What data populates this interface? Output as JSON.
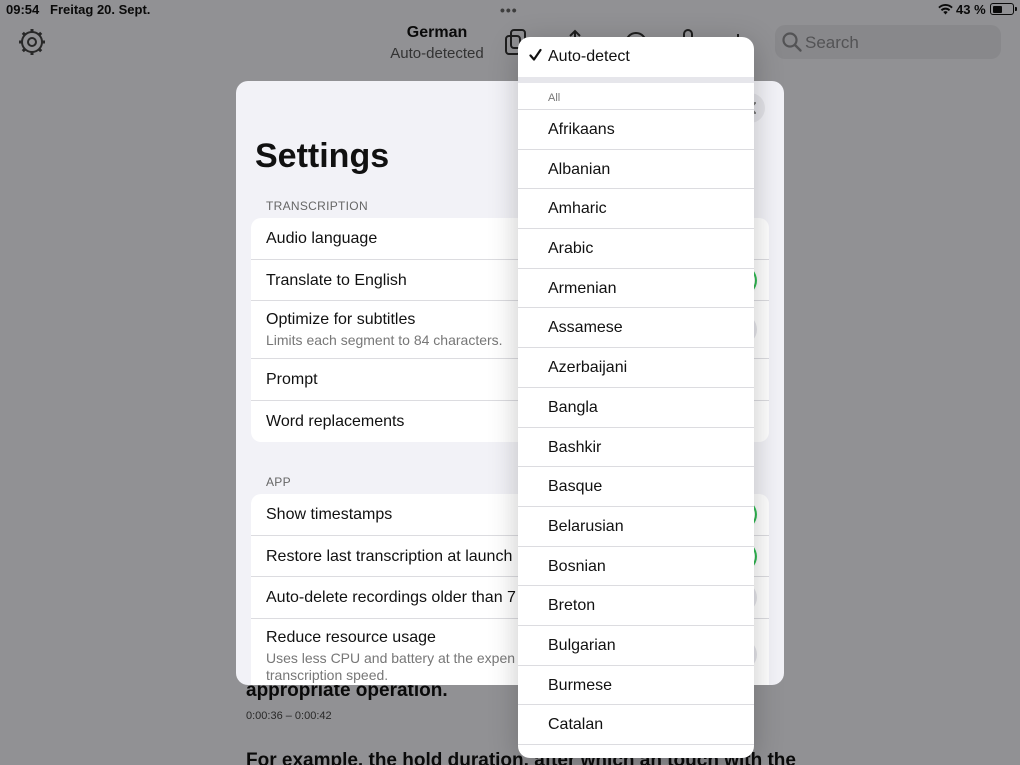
{
  "status_bar": {
    "time": "09:54",
    "date": "Freitag 20. Sept.",
    "battery": "43 %",
    "battery_level": 0.43
  },
  "header": {
    "title": "German",
    "subtitle": "Auto-detected"
  },
  "search": {
    "placeholder": "Search"
  },
  "icons": {
    "settings": "gear-icon",
    "copy": "copy-icon",
    "share": "share-icon",
    "record": "record-icon",
    "mic": "microphone-icon",
    "add": "plus-icon",
    "search": "search-icon",
    "close": "close-icon",
    "checkmark": "checkmark-icon"
  },
  "colors": {
    "toggle_on": "#34c759",
    "toggle_off": "#e5e5ea"
  },
  "transcript": {
    "segment_text": "appropriate operation.",
    "segment_time": "0:00:36 – 0:00:42",
    "next_segment_text": "For example, the hold duration, after which an touch with the"
  },
  "settings": {
    "title": "Settings",
    "transcription": {
      "header": "TRANSCRIPTION",
      "audio_language": "Audio language",
      "translate": "Translate to English",
      "optimize": "Optimize for subtitles",
      "optimize_sub": "Limits each segment to 84 characters.",
      "prompt": "Prompt",
      "word_replacements": "Word replacements"
    },
    "app": {
      "header": "APP",
      "show_timestamps": "Show timestamps",
      "restore": "Restore last transcription at launch",
      "auto_delete": "Auto-delete recordings older than 7",
      "reduce": "Reduce resource usage",
      "reduce_sub": "Uses less CPU and battery at the expen",
      "reduce_sub2": "transcription speed."
    }
  },
  "language_menu": {
    "selected": "Auto-detect",
    "section_label": "All",
    "items": [
      "Afrikaans",
      "Albanian",
      "Amharic",
      "Arabic",
      "Armenian",
      "Assamese",
      "Azerbaijani",
      "Bangla",
      "Bashkir",
      "Basque",
      "Belarusian",
      "Bosnian",
      "Breton",
      "Bulgarian",
      "Burmese",
      "Catalan"
    ]
  }
}
